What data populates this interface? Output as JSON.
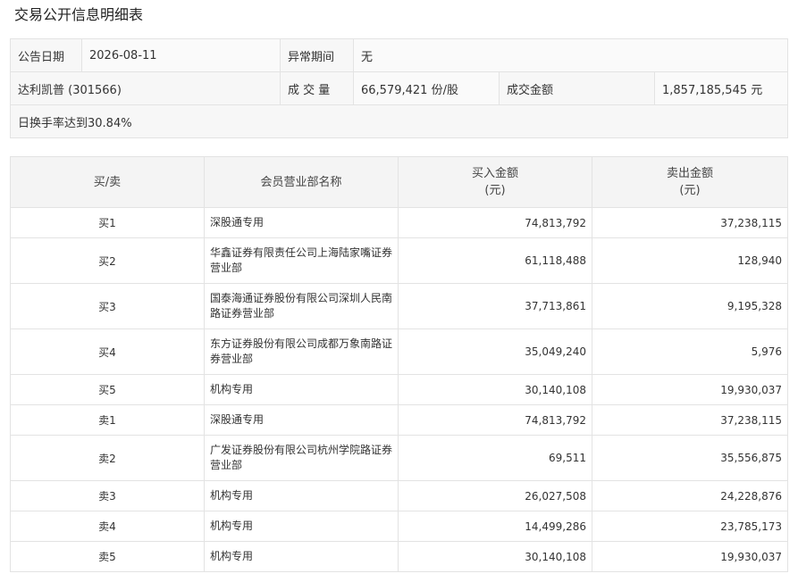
{
  "page": {
    "title": "交易公开信息明细表"
  },
  "info": {
    "announce_date_label": "公告日期",
    "announce_date": "2026-08-11",
    "abnormal_period_label": "异常期间",
    "abnormal_period": "无",
    "stock": "达利凯普 (301566)",
    "volume_label": "成 交 量",
    "volume": "66,579,421 份/股",
    "amount_label": "成交金额",
    "amount": "1,857,185,545 元",
    "reason": "日换手率达到30.84%"
  },
  "table": {
    "headers": {
      "side": "买/卖",
      "member": "会员营业部名称",
      "buy_line1": "买入金额",
      "buy_line2": "(元)",
      "sell_line1": "卖出金额",
      "sell_line2": "(元)"
    },
    "rows": [
      {
        "side": "买1",
        "name": "深股通专用",
        "buy": "74,813,792",
        "sell": "37,238,115"
      },
      {
        "side": "买2",
        "name": "华鑫证券有限责任公司上海陆家嘴证券营业部",
        "buy": "61,118,488",
        "sell": "128,940"
      },
      {
        "side": "买3",
        "name": "国泰海通证券股份有限公司深圳人民南路证券营业部",
        "buy": "37,713,861",
        "sell": "9,195,328"
      },
      {
        "side": "买4",
        "name": "东方证券股份有限公司成都万象南路证券营业部",
        "buy": "35,049,240",
        "sell": "5,976"
      },
      {
        "side": "买5",
        "name": "机构专用",
        "buy": "30,140,108",
        "sell": "19,930,037"
      },
      {
        "side": "卖1",
        "name": "深股通专用",
        "buy": "74,813,792",
        "sell": "37,238,115"
      },
      {
        "side": "卖2",
        "name": "广发证券股份有限公司杭州学院路证券营业部",
        "buy": "69,511",
        "sell": "35,556,875"
      },
      {
        "side": "卖3",
        "name": "机构专用",
        "buy": "26,027,508",
        "sell": "24,228,876"
      },
      {
        "side": "卖4",
        "name": "机构专用",
        "buy": "14,499,286",
        "sell": "23,785,173"
      },
      {
        "side": "卖5",
        "name": "机构专用",
        "buy": "30,140,108",
        "sell": "19,930,037"
      }
    ]
  }
}
